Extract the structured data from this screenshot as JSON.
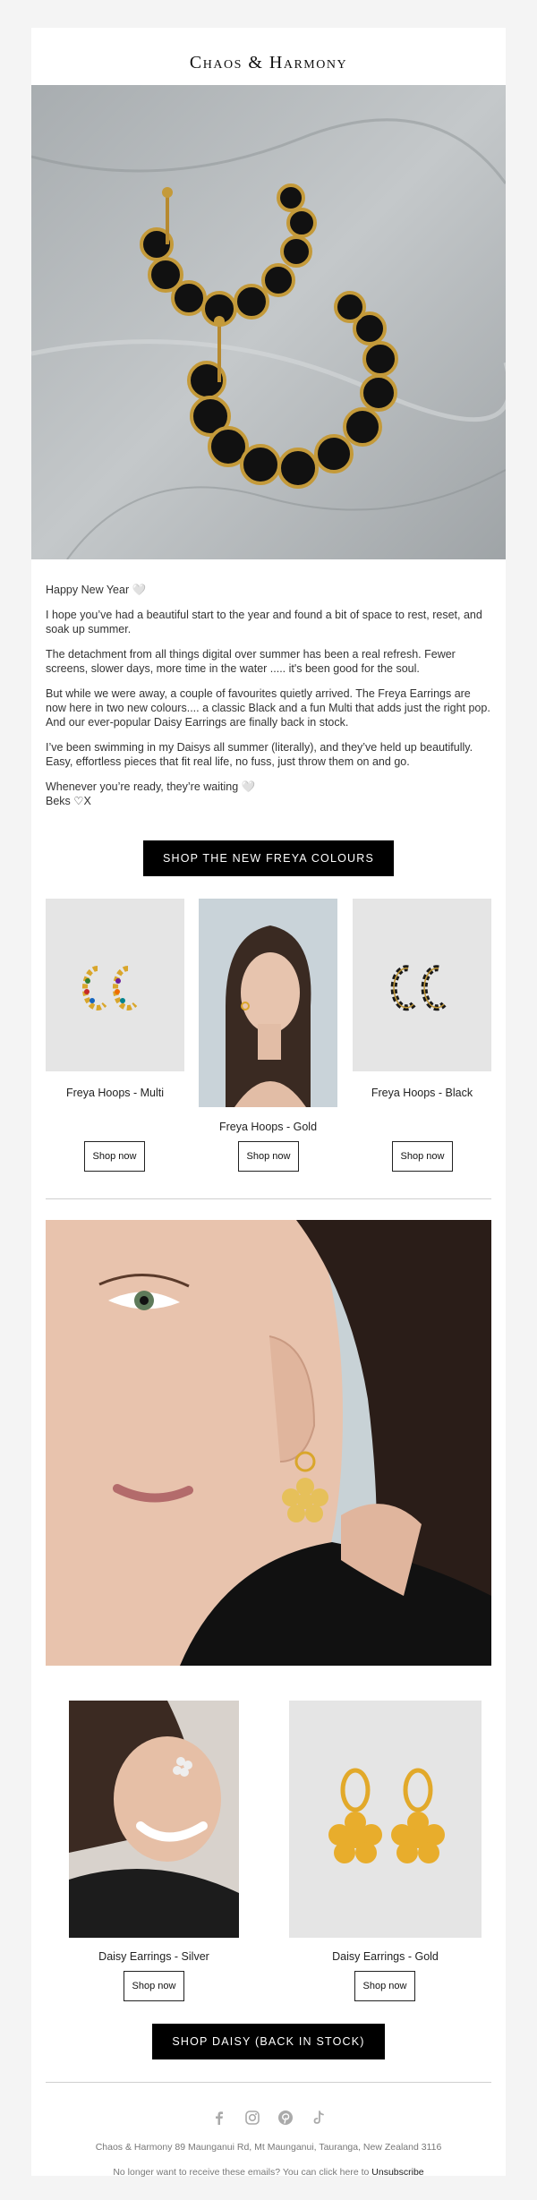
{
  "brand": {
    "name": "Chaos & Harmony"
  },
  "hero": {
    "image_alt": "Black and gold Freya hoop earrings on marble"
  },
  "body": {
    "greeting": "Happy New Year 🤍",
    "p1": "I hope you’ve had a beautiful start to the year and found a bit of space to rest, reset, and soak up summer.",
    "p2": "The detachment from all things digital over summer has been a real refresh. Fewer screens, slower days, more time in the water ..... it's been good for the soul.",
    "p3": "But while we were away, a couple of favourites quietly arrived. The Freya Earrings are now here in two new colours.... a classic Black and a fun Multi that adds just the right pop. And our ever-popular Daisy Earrings are finally back in stock.",
    "p4": "I’ve been swimming in my Daisys all summer (literally), and they’ve held up beautifully. Easy, effortless pieces that fit real life, no fuss, just throw them on and go.",
    "p5a": "Whenever you’re ready, they’re waiting 🤍",
    "p5b": "Beks ♡X"
  },
  "cta_freya": "SHOP THE NEW FREYA COLOURS",
  "freya_products": [
    {
      "name": "Freya Hoops - Multi",
      "button": "Shop now"
    },
    {
      "name": "Freya Hoops - Gold",
      "button": "Shop now"
    },
    {
      "name": "Freya Hoops - Black",
      "button": "Shop now"
    }
  ],
  "daisy_products": [
    {
      "name": "Daisy Earrings - Silver",
      "button": "Shop now"
    },
    {
      "name": "Daisy Earrings - Gold",
      "button": "Shop now"
    }
  ],
  "cta_daisy": "SHOP DAISY (BACK IN STOCK)",
  "social_icons": [
    "facebook-icon",
    "instagram-icon",
    "pinterest-icon",
    "tiktok-icon"
  ],
  "footer": {
    "address": "Chaos & Harmony 89 Maunganui Rd, Mt Maunganui, Tauranga, New Zealand 3116",
    "unsub_text": "No longer want to receive these emails? You can click here to",
    "unsub_link": "Unsubscribe"
  },
  "colors": {
    "background": "#f4f4f4",
    "card": "#ffffff",
    "button": "#000000",
    "accent_gold": "#d9a62b"
  }
}
